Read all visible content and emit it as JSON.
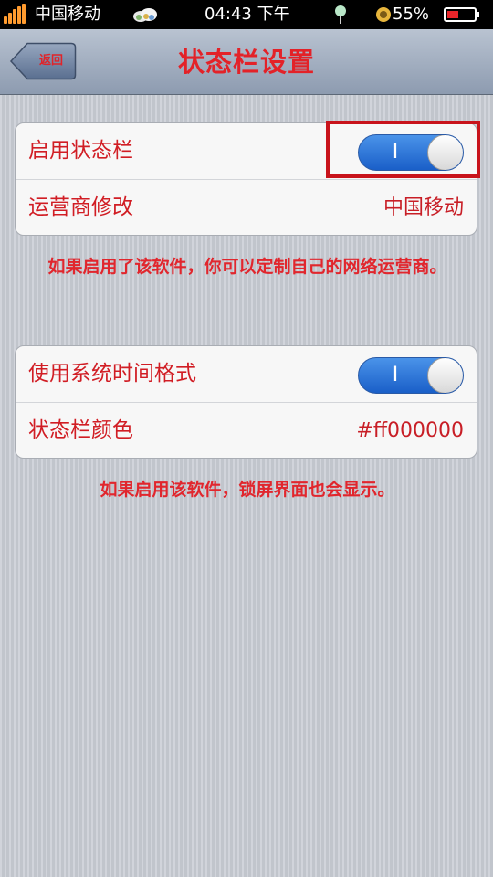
{
  "status_bar": {
    "carrier": "中国移动",
    "time": "04:43 下午",
    "battery_percent": "55%",
    "signal_color": "#ff9b2f"
  },
  "nav_bar": {
    "back_label": "返回",
    "title": "状态栏设置"
  },
  "groups": [
    {
      "rows": [
        {
          "label": "启用状态栏",
          "type": "toggle",
          "value": true,
          "toggle_text": "I"
        },
        {
          "label": "运营商修改",
          "type": "value",
          "value": "中国移动"
        }
      ],
      "note": "如果启用了该软件，你可以定制自己的网络运营商。"
    },
    {
      "rows": [
        {
          "label": "使用系统时间格式",
          "type": "toggle",
          "value": true,
          "toggle_text": "I"
        },
        {
          "label": "状态栏颜色",
          "type": "value",
          "value": "#ff000000"
        }
      ],
      "note": "如果启用该软件，锁屏界面也会显示。"
    }
  ],
  "colors": {
    "accent_red": "#e32228",
    "toggle_blue": "#1a5fc8",
    "highlight_red": "#c8131b"
  },
  "icons": [
    "signal-bars-icon",
    "weather-cloud-icon",
    "location-pin-icon",
    "alarm-icon",
    "battery-icon"
  ]
}
